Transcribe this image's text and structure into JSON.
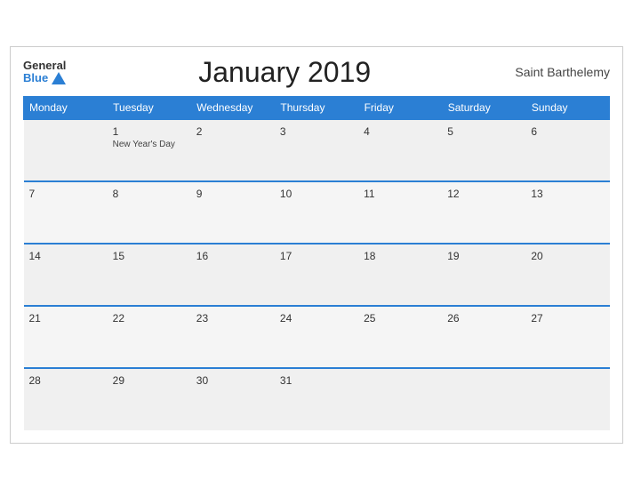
{
  "header": {
    "logo_general": "General",
    "logo_blue": "Blue",
    "title": "January 2019",
    "region": "Saint Barthelemy"
  },
  "days_of_week": [
    "Monday",
    "Tuesday",
    "Wednesday",
    "Thursday",
    "Friday",
    "Saturday",
    "Sunday"
  ],
  "weeks": [
    [
      {
        "day": "",
        "holiday": ""
      },
      {
        "day": "1",
        "holiday": "New Year's Day"
      },
      {
        "day": "2",
        "holiday": ""
      },
      {
        "day": "3",
        "holiday": ""
      },
      {
        "day": "4",
        "holiday": ""
      },
      {
        "day": "5",
        "holiday": ""
      },
      {
        "day": "6",
        "holiday": ""
      }
    ],
    [
      {
        "day": "7",
        "holiday": ""
      },
      {
        "day": "8",
        "holiday": ""
      },
      {
        "day": "9",
        "holiday": ""
      },
      {
        "day": "10",
        "holiday": ""
      },
      {
        "day": "11",
        "holiday": ""
      },
      {
        "day": "12",
        "holiday": ""
      },
      {
        "day": "13",
        "holiday": ""
      }
    ],
    [
      {
        "day": "14",
        "holiday": ""
      },
      {
        "day": "15",
        "holiday": ""
      },
      {
        "day": "16",
        "holiday": ""
      },
      {
        "day": "17",
        "holiday": ""
      },
      {
        "day": "18",
        "holiday": ""
      },
      {
        "day": "19",
        "holiday": ""
      },
      {
        "day": "20",
        "holiday": ""
      }
    ],
    [
      {
        "day": "21",
        "holiday": ""
      },
      {
        "day": "22",
        "holiday": ""
      },
      {
        "day": "23",
        "holiday": ""
      },
      {
        "day": "24",
        "holiday": ""
      },
      {
        "day": "25",
        "holiday": ""
      },
      {
        "day": "26",
        "holiday": ""
      },
      {
        "day": "27",
        "holiday": ""
      }
    ],
    [
      {
        "day": "28",
        "holiday": ""
      },
      {
        "day": "29",
        "holiday": ""
      },
      {
        "day": "30",
        "holiday": ""
      },
      {
        "day": "31",
        "holiday": ""
      },
      {
        "day": "",
        "holiday": ""
      },
      {
        "day": "",
        "holiday": ""
      },
      {
        "day": "",
        "holiday": ""
      }
    ]
  ]
}
